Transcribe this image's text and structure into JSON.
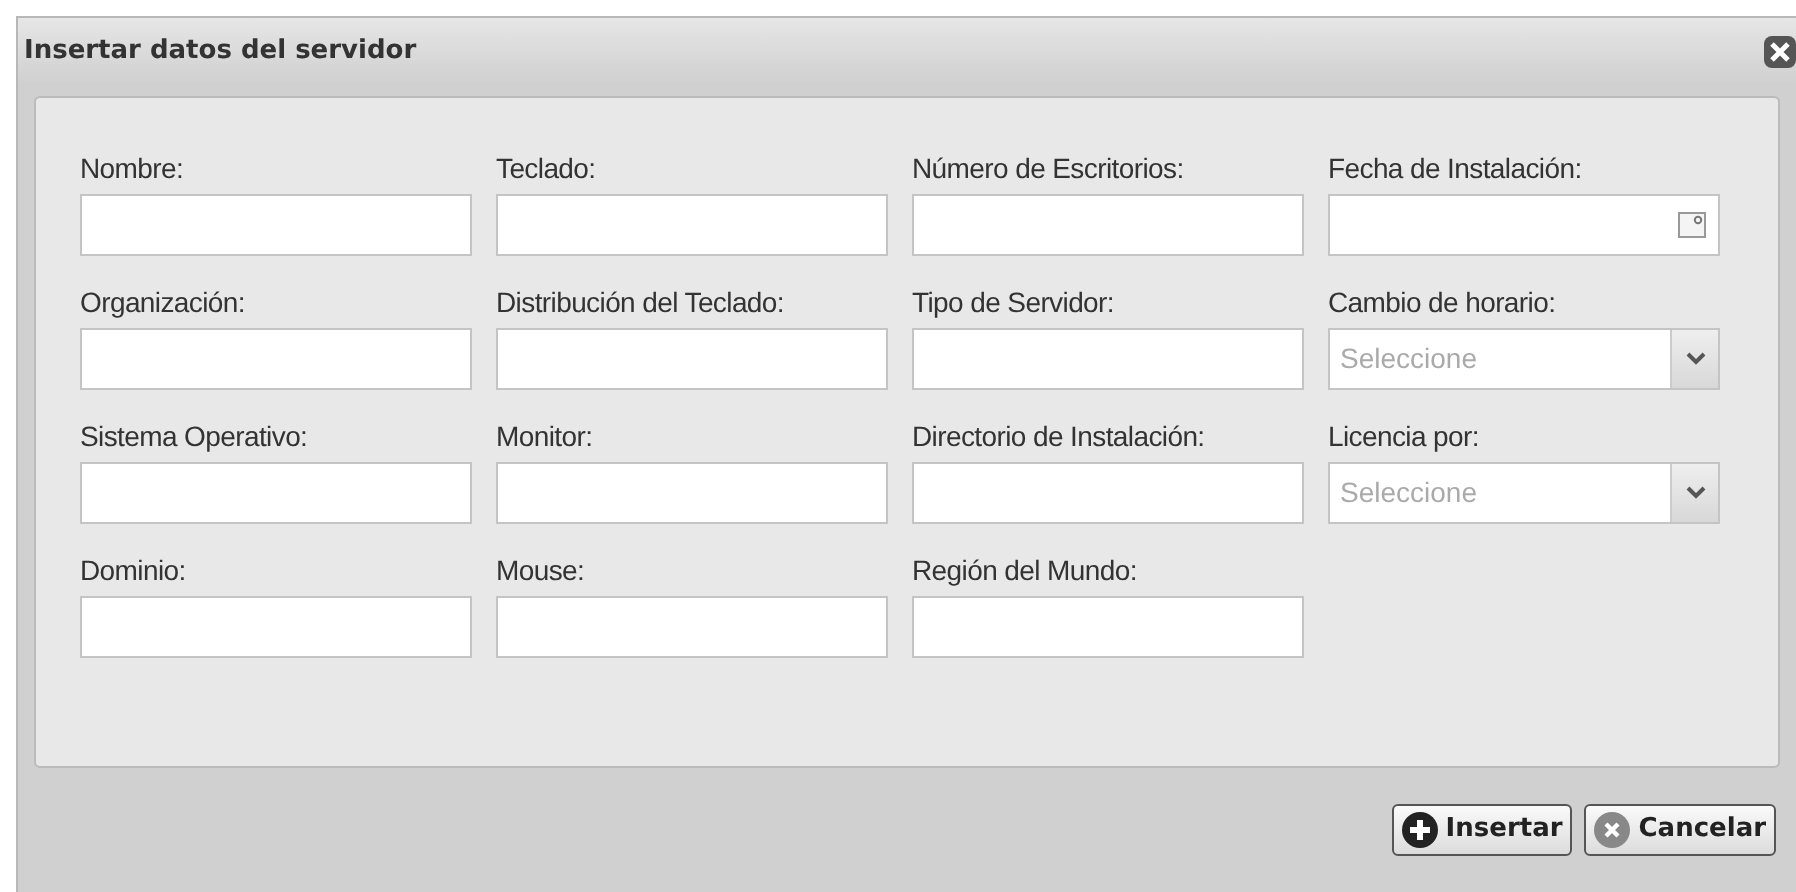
{
  "window": {
    "title": "Insertar datos del servidor"
  },
  "fields": [
    {
      "label": "Nombre:",
      "kind": "text"
    },
    {
      "label": "Teclado:",
      "kind": "text"
    },
    {
      "label": "Número de Escritorios:",
      "kind": "text"
    },
    {
      "label": "Fecha de Instalación:",
      "kind": "date"
    },
    {
      "label": "Organización:",
      "kind": "text"
    },
    {
      "label": "Distribución del Teclado:",
      "kind": "text"
    },
    {
      "label": "Tipo de Servidor:",
      "kind": "text"
    },
    {
      "label": "Cambio de horario:",
      "kind": "select",
      "placeholder": "Seleccione"
    },
    {
      "label": "Sistema Operativo:",
      "kind": "text"
    },
    {
      "label": "Monitor:",
      "kind": "text"
    },
    {
      "label": "Directorio de Instalación:",
      "kind": "text"
    },
    {
      "label": "Licencia por:",
      "kind": "select",
      "placeholder": "Seleccione"
    },
    {
      "label": "Dominio:",
      "kind": "text"
    },
    {
      "label": "Mouse:",
      "kind": "text"
    },
    {
      "label": "Región del Mundo:",
      "kind": "text"
    }
  ],
  "buttons": [
    {
      "label": "Insertar",
      "kind": "add"
    },
    {
      "label": "Cancelar",
      "kind": "cancel"
    }
  ]
}
